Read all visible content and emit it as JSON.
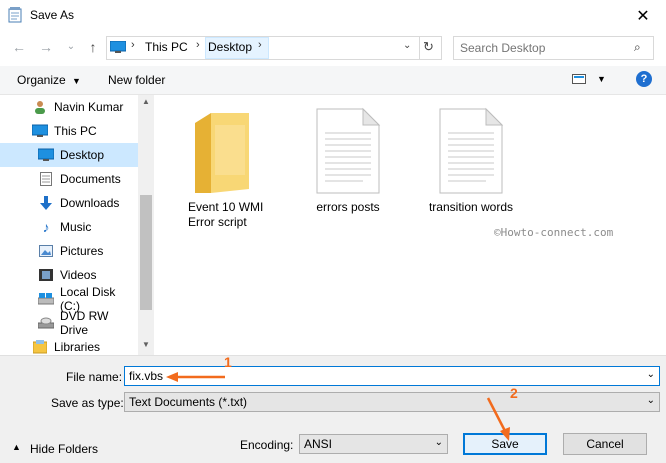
{
  "window": {
    "title": "Save As"
  },
  "nav": {
    "breadcrumb": [
      "This PC",
      "Desktop"
    ],
    "search_placeholder": "Search Desktop"
  },
  "toolbar": {
    "organize_label": "Organize",
    "new_folder_label": "New folder",
    "help_label": "?"
  },
  "sidebar": {
    "items": [
      {
        "label": "Navin Kumar",
        "icon": "user-icon"
      },
      {
        "label": "This PC",
        "icon": "pc-icon"
      },
      {
        "label": "Desktop",
        "icon": "desktop-icon",
        "selected": true
      },
      {
        "label": "Documents",
        "icon": "documents-icon"
      },
      {
        "label": "Downloads",
        "icon": "downloads-icon"
      },
      {
        "label": "Music",
        "icon": "music-icon"
      },
      {
        "label": "Pictures",
        "icon": "pictures-icon"
      },
      {
        "label": "Videos",
        "icon": "videos-icon"
      },
      {
        "label": "Local Disk (C:)",
        "icon": "disk-icon"
      },
      {
        "label": "DVD RW Drive",
        "icon": "dvd-icon"
      },
      {
        "label": "Libraries",
        "icon": "libraries-icon"
      }
    ]
  },
  "files": [
    {
      "name": "Event 10 WMI Error script",
      "type": "folder"
    },
    {
      "name": "errors posts",
      "type": "document"
    },
    {
      "name": "transition words",
      "type": "document"
    }
  ],
  "watermark": "©Howto-connect.com",
  "form": {
    "filename_label": "File name:",
    "filename_value": "fix.vbs",
    "saveas_label": "Save as type:",
    "saveas_value": "Text Documents (*.txt)",
    "encoding_label": "Encoding:",
    "encoding_value": "ANSI",
    "hide_folders_label": "Hide Folders",
    "save_label": "Save",
    "cancel_label": "Cancel"
  },
  "annotations": {
    "step1": "1",
    "step2": "2"
  },
  "colors": {
    "accent": "#0078d7",
    "selection": "#cce8ff",
    "annotation": "#f26b1d",
    "folder": "#f5c542"
  }
}
